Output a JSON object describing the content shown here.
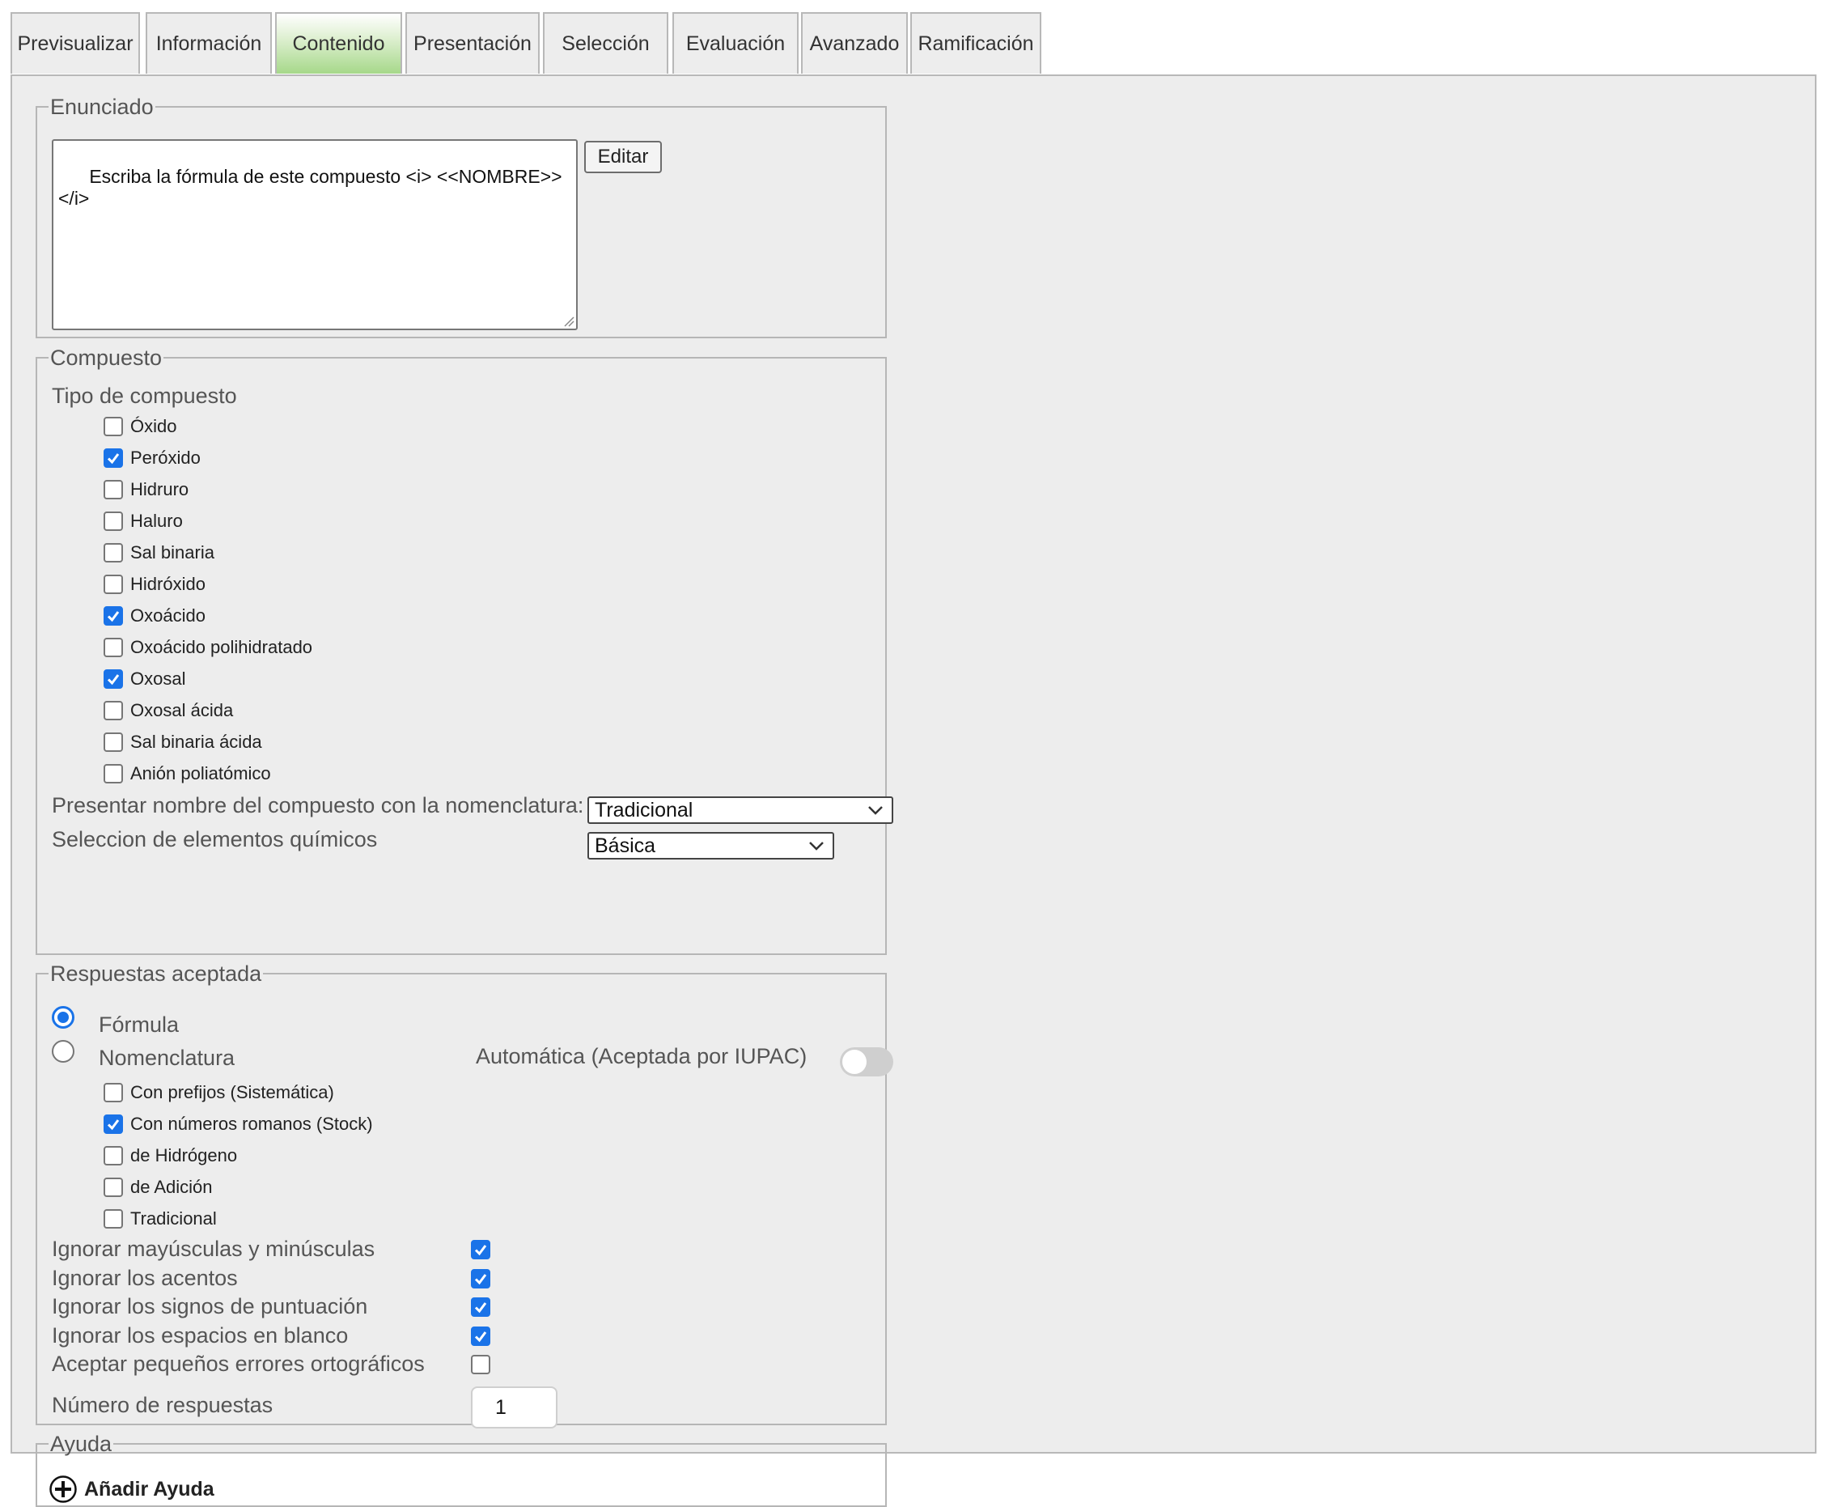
{
  "tabs": [
    "Previsualizar",
    "Información",
    "Contenido",
    "Presentación",
    "Selección",
    "Evaluación",
    "Avanzado",
    "Ramificación"
  ],
  "active_tab": "Contenido",
  "enunciado": {
    "legend": "Enunciado",
    "text": "Escriba la fórmula de este compuesto <i> <<NOMBRE>> </i>",
    "edit_label": "Editar"
  },
  "compuesto": {
    "legend": "Compuesto",
    "tipo_label": "Tipo de compuesto",
    "tipos": [
      {
        "label": "Óxido",
        "checked": false
      },
      {
        "label": "Peróxido",
        "checked": true
      },
      {
        "label": "Hidruro",
        "checked": false
      },
      {
        "label": "Haluro",
        "checked": false
      },
      {
        "label": "Sal binaria",
        "checked": false
      },
      {
        "label": "Hidróxido",
        "checked": false
      },
      {
        "label": "Oxoácido",
        "checked": true
      },
      {
        "label": "Oxoácido polihidratado",
        "checked": false
      },
      {
        "label": "Oxosal",
        "checked": true
      },
      {
        "label": "Oxosal ácida",
        "checked": false
      },
      {
        "label": "Sal binaria ácida",
        "checked": false
      },
      {
        "label": "Anión poliatómico",
        "checked": false
      }
    ],
    "nomenclatura_label": "Presentar nombre del compuesto con la nomenclatura:",
    "nomenclatura_value": "Tradicional",
    "elementos_label": "Seleccion de elementos químicos",
    "elementos_value": "Básica"
  },
  "respuestas": {
    "legend": "Respuestas aceptada",
    "formula_label": "Fórmula",
    "formula_selected": true,
    "nomenclatura_label": "Nomenclatura",
    "nomenclatura_selected": false,
    "automatica_label": "Automática (Aceptada por IUPAC)",
    "automatica_on": false,
    "tipos": [
      {
        "label": "Con prefijos (Sistemática)",
        "checked": false
      },
      {
        "label": "Con números romanos (Stock)",
        "checked": true
      },
      {
        "label": "de Hidrógeno",
        "checked": false
      },
      {
        "label": "de Adición",
        "checked": false
      },
      {
        "label": "Tradicional",
        "checked": false
      }
    ],
    "opciones": [
      {
        "label": "Ignorar mayúsculas y minúsculas",
        "checked": true
      },
      {
        "label": "Ignorar los acentos",
        "checked": true
      },
      {
        "label": "Ignorar los signos de puntuación",
        "checked": true
      },
      {
        "label": "Ignorar los espacios en blanco",
        "checked": true
      },
      {
        "label": "Aceptar pequeños errores ortográficos",
        "checked": false
      }
    ],
    "numero_label": "Número de respuestas",
    "numero_value": "1"
  },
  "ayuda": {
    "legend": "Ayuda",
    "add_label": "Añadir Ayuda"
  }
}
